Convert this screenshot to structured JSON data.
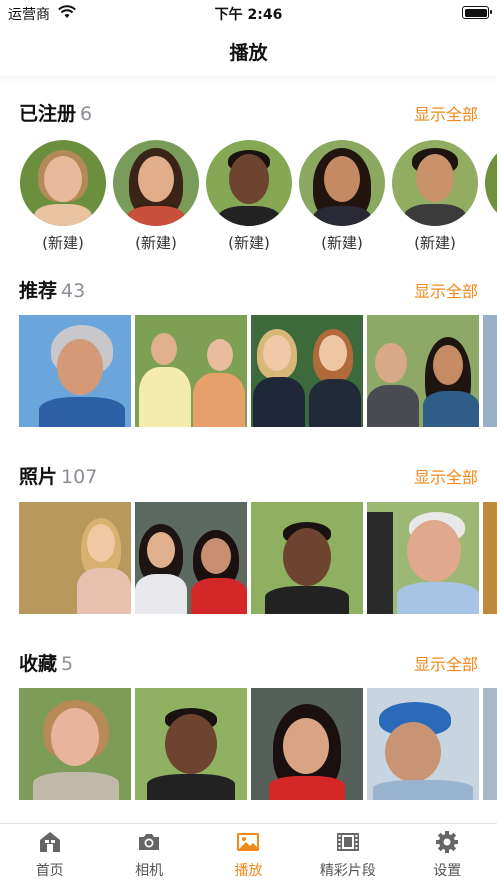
{
  "status_bar": {
    "carrier": "运营商",
    "time": "下午 2:46"
  },
  "nav": {
    "title": "播放"
  },
  "registered": {
    "title": "已注册",
    "count": "6",
    "show_all": "显示全部",
    "items": [
      {
        "caption": "(新建)"
      },
      {
        "caption": "(新建)"
      },
      {
        "caption": "(新建)"
      },
      {
        "caption": "(新建)"
      },
      {
        "caption": "(新建)"
      }
    ]
  },
  "recommended": {
    "title": "推荐",
    "count": "43",
    "show_all": "显示全部"
  },
  "photos": {
    "title": "照片",
    "count": "107",
    "show_all": "显示全部"
  },
  "favorites": {
    "title": "收藏",
    "count": "5",
    "show_all": "显示全部"
  },
  "tabs": [
    {
      "label": "首页",
      "icon": "home-icon"
    },
    {
      "label": "相机",
      "icon": "camera-icon"
    },
    {
      "label": "播放",
      "icon": "photo-icon"
    },
    {
      "label": "精彩片段",
      "icon": "film-icon"
    },
    {
      "label": "设置",
      "icon": "gear-icon"
    }
  ],
  "colors": {
    "accent": "#f08a1c",
    "count_gray": "#8a8e95"
  }
}
